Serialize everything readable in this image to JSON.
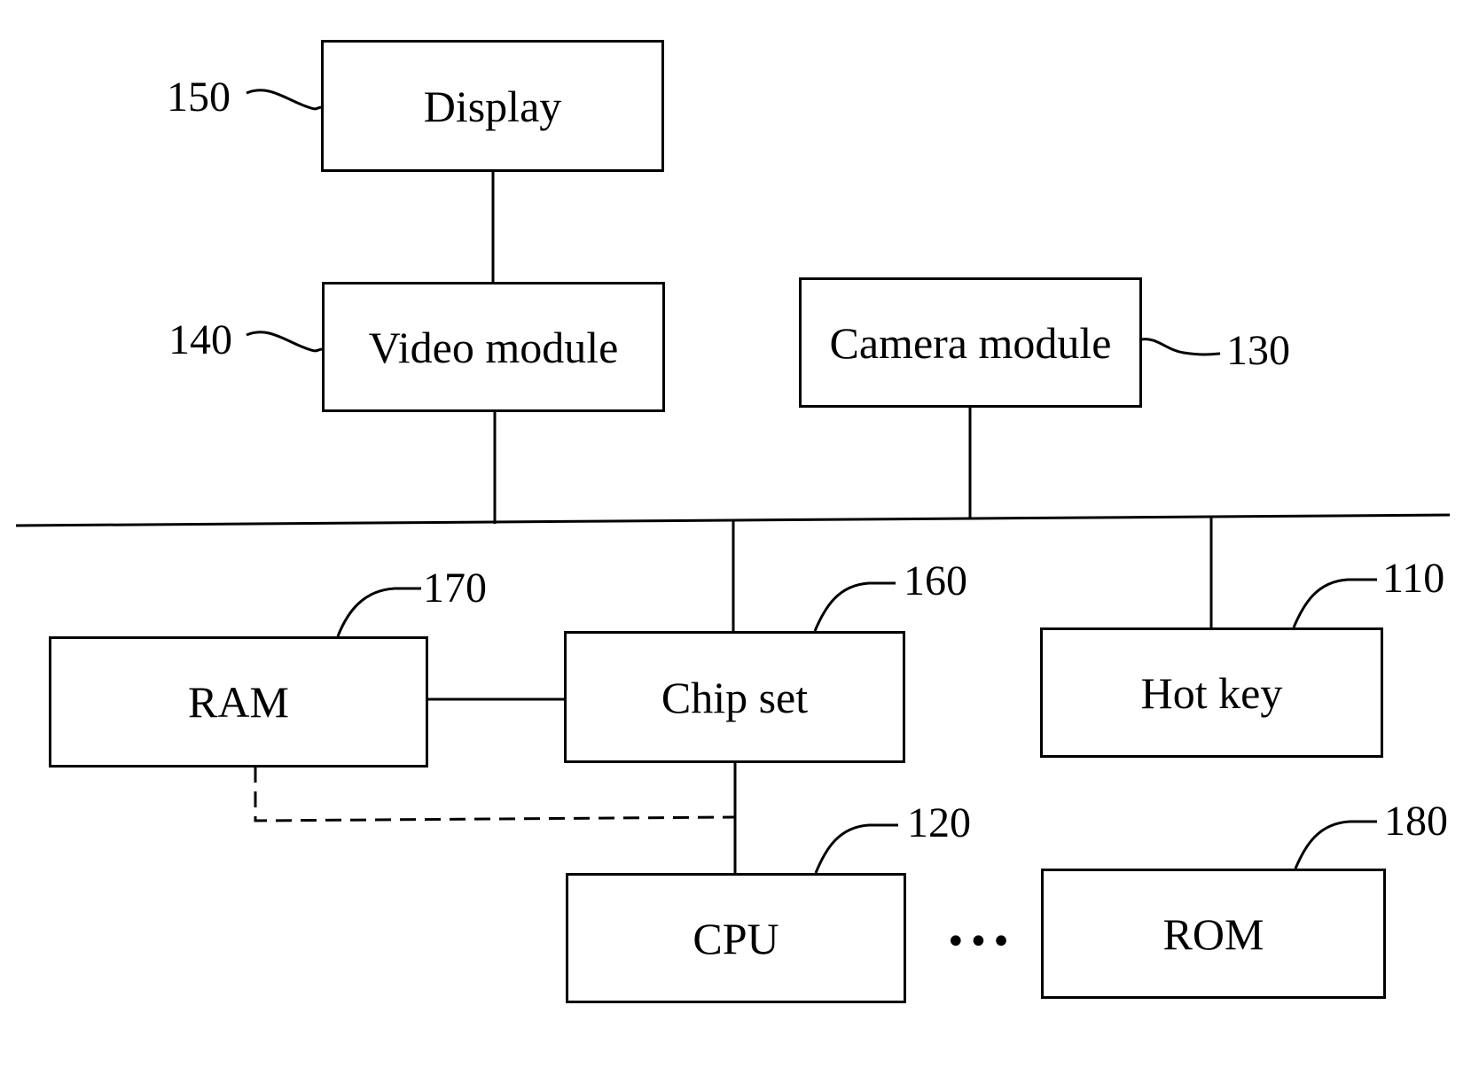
{
  "diagram": {
    "type": "block-diagram",
    "blocks": [
      {
        "id": "display",
        "label": "Display",
        "ref": "150"
      },
      {
        "id": "video",
        "label": "Video module",
        "ref": "140"
      },
      {
        "id": "camera",
        "label": "Camera module",
        "ref": "130"
      },
      {
        "id": "ram",
        "label": "RAM",
        "ref": "170"
      },
      {
        "id": "chipset",
        "label": "Chip set",
        "ref": "160"
      },
      {
        "id": "hotkey",
        "label": "Hot key",
        "ref": "110"
      },
      {
        "id": "cpu",
        "label": "CPU",
        "ref": "120"
      },
      {
        "id": "rom",
        "label": "ROM",
        "ref": "180"
      }
    ],
    "connections": [
      {
        "from": "display",
        "to": "video",
        "style": "solid"
      },
      {
        "from": "video",
        "to": "bus",
        "style": "solid"
      },
      {
        "from": "camera",
        "to": "bus",
        "style": "solid"
      },
      {
        "from": "chipset",
        "to": "bus",
        "style": "solid"
      },
      {
        "from": "hotkey",
        "to": "bus",
        "style": "solid"
      },
      {
        "from": "ram",
        "to": "chipset",
        "style": "solid"
      },
      {
        "from": "chipset",
        "to": "cpu",
        "style": "solid"
      },
      {
        "from": "ram",
        "to": "cpu-link",
        "style": "dashed"
      }
    ],
    "ellipsis": "•••"
  }
}
